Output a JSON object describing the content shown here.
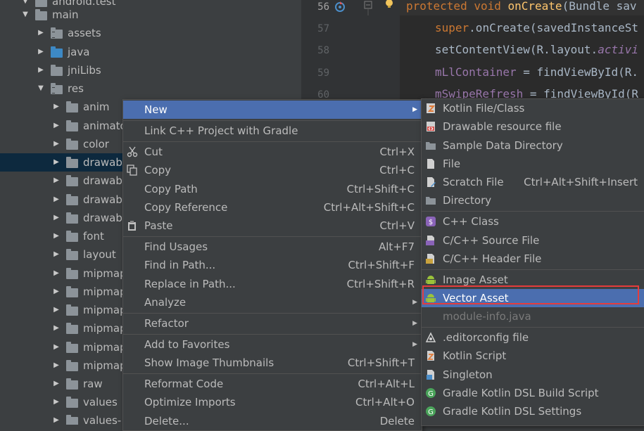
{
  "tree": {
    "rows": [
      {
        "label": "android.test",
        "type": "folder"
      },
      {
        "label": "main",
        "type": "folder"
      },
      {
        "label": "assets",
        "type": "folder-res"
      },
      {
        "label": "java",
        "type": "folder-blue"
      },
      {
        "label": "jniLibs",
        "type": "folder"
      },
      {
        "label": "res",
        "type": "folder-res"
      },
      {
        "label": "anim",
        "type": "folder"
      },
      {
        "label": "animato",
        "type": "folder"
      },
      {
        "label": "color",
        "type": "folder"
      },
      {
        "label": "drawab",
        "type": "folder"
      },
      {
        "label": "drawab",
        "type": "folder"
      },
      {
        "label": "drawab",
        "type": "folder"
      },
      {
        "label": "drawab",
        "type": "folder"
      },
      {
        "label": "font",
        "type": "folder"
      },
      {
        "label": "layout",
        "type": "folder"
      },
      {
        "label": "mipmap",
        "type": "folder"
      },
      {
        "label": "mipmap",
        "type": "folder"
      },
      {
        "label": "mipmap",
        "type": "folder"
      },
      {
        "label": "mipmap",
        "type": "folder"
      },
      {
        "label": "mipmap",
        "type": "folder"
      },
      {
        "label": "mipmap",
        "type": "folder"
      },
      {
        "label": "raw",
        "type": "folder"
      },
      {
        "label": "values",
        "type": "folder"
      },
      {
        "label": "values-",
        "type": "folder"
      }
    ]
  },
  "editor": {
    "line_numbers": [
      "56",
      "57",
      "58",
      "59",
      "60"
    ],
    "lines": [
      {
        "kw": "protected void ",
        "fn": "onCreate",
        "rest": "(Bundle sav"
      },
      {
        "sup": "super",
        "rest": ".onCreate(savedInstanceSt"
      },
      {
        "rest": "setContentView(R.layout.",
        "it": "activi"
      },
      {
        "field": "mLlContainer",
        "rest": " = findViewById(R."
      },
      {
        "field": "mSwipeRefresh",
        "rest": " = findViewById(R"
      }
    ]
  },
  "context_menu": {
    "items": [
      {
        "label": "New",
        "shortcut": "",
        "submenu": true,
        "highlight": true
      },
      {
        "label": "Link C++ Project with Gradle",
        "shortcut": ""
      },
      {
        "label": "Cut",
        "shortcut": "Ctrl+X",
        "icon": "scissors-icon"
      },
      {
        "label": "Copy",
        "shortcut": "Ctrl+C",
        "icon": "copy-icon"
      },
      {
        "label": "Copy Path",
        "shortcut": "Ctrl+Shift+C"
      },
      {
        "label": "Copy Reference",
        "shortcut": "Ctrl+Alt+Shift+C"
      },
      {
        "label": "Paste",
        "shortcut": "Ctrl+V",
        "icon": "clipboard-icon"
      },
      {
        "label": "Find Usages",
        "shortcut": "Alt+F7"
      },
      {
        "label": "Find in Path...",
        "shortcut": "Ctrl+Shift+F"
      },
      {
        "label": "Replace in Path...",
        "shortcut": "Ctrl+Shift+R"
      },
      {
        "label": "Analyze",
        "shortcut": "",
        "submenu": true
      },
      {
        "label": "Refactor",
        "shortcut": "",
        "submenu": true
      },
      {
        "label": "Add to Favorites",
        "shortcut": "",
        "submenu": true
      },
      {
        "label": "Show Image Thumbnails",
        "shortcut": "Ctrl+Shift+T"
      },
      {
        "label": "Reformat Code",
        "shortcut": "Ctrl+Alt+L"
      },
      {
        "label": "Optimize Imports",
        "shortcut": "Ctrl+Alt+O"
      },
      {
        "label": "Delete...",
        "shortcut": "Delete"
      }
    ]
  },
  "submenu": {
    "items": [
      {
        "label": "Kotlin File/Class",
        "shortcut": "",
        "icon": "kotlin-file-icon"
      },
      {
        "label": "Drawable resource file",
        "shortcut": "",
        "icon": "drawable-file-icon"
      },
      {
        "label": "Sample Data Directory",
        "shortcut": "",
        "icon": "folder-icon"
      },
      {
        "label": "File",
        "shortcut": "",
        "icon": "file-icon"
      },
      {
        "label": "Scratch File",
        "shortcut": "Ctrl+Alt+Shift+Insert",
        "icon": "scratch-file-icon"
      },
      {
        "label": "Directory",
        "shortcut": "",
        "icon": "folder-icon"
      },
      {
        "label": "C++ Class",
        "shortcut": "",
        "icon": "cpp-class-icon"
      },
      {
        "label": "C/C++ Source File",
        "shortcut": "",
        "icon": "cpp-source-icon"
      },
      {
        "label": "C/C++ Header File",
        "shortcut": "",
        "icon": "cpp-header-icon"
      },
      {
        "label": "Image Asset",
        "shortcut": "",
        "icon": "android-icon"
      },
      {
        "label": "Vector Asset",
        "shortcut": "",
        "icon": "android-icon",
        "highlight": true
      },
      {
        "label": "module-info.java",
        "shortcut": "",
        "disabled": true
      },
      {
        "label": ".editorconfig file",
        "shortcut": "",
        "icon": "editorconfig-icon"
      },
      {
        "label": "Kotlin Script",
        "shortcut": "",
        "icon": "kotlin-script-icon"
      },
      {
        "label": "Singleton",
        "shortcut": "",
        "icon": "singleton-icon"
      },
      {
        "label": "Gradle Kotlin DSL Build Script",
        "shortcut": "",
        "icon": "gradle-icon"
      },
      {
        "label": "Gradle Kotlin DSL Settings",
        "shortcut": "",
        "icon": "gradle-icon"
      }
    ]
  },
  "colors": {
    "menu_highlight": "#4b6eaf",
    "tree_selection": "#0d293e",
    "callout_border": "#e53c3c"
  }
}
